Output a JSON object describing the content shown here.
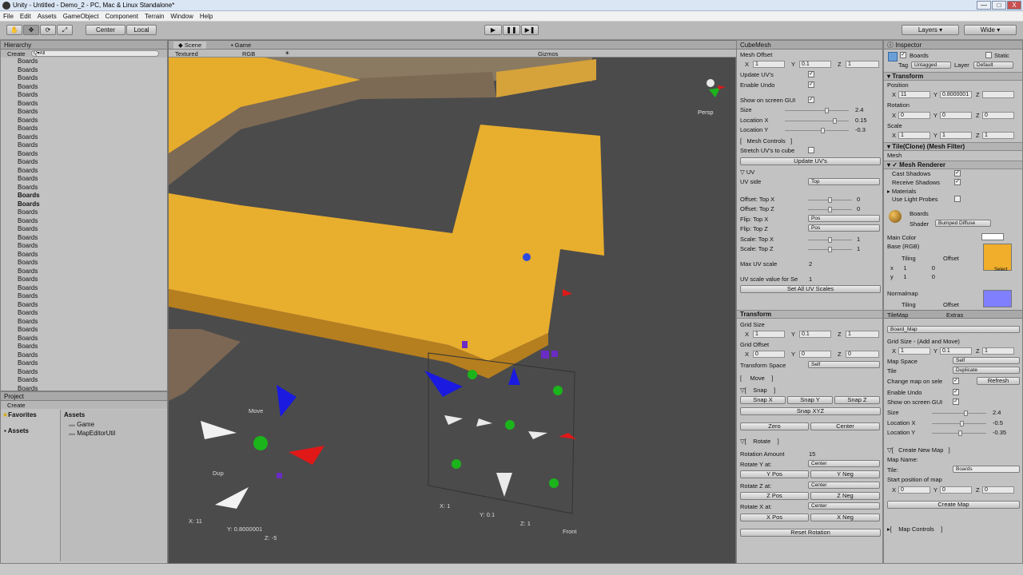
{
  "window": {
    "title": "Unity - Untitled - Demo_2 - PC, Mac & Linux Standalone*",
    "min": "—",
    "max": "□",
    "close": "X"
  },
  "menu": [
    "File",
    "Edit",
    "Assets",
    "GameObject",
    "Component",
    "Terrain",
    "Window",
    "Help"
  ],
  "toolbar": {
    "center": "Center",
    "local": "Local",
    "layers": "Layers",
    "layout": "Wide"
  },
  "hierarchy": {
    "title": "Hierarchy",
    "create": "Create",
    "search": "Q▾All",
    "items": [
      "Boards",
      "Boards",
      "Boards",
      "Boards",
      "Boards",
      "Boards",
      "Boards",
      "Boards",
      "Boards",
      "Boards",
      "Boards",
      "Boards",
      "Boards",
      "Boards",
      "Boards",
      "Boards",
      "Boards",
      "Boards",
      "Boards",
      "Boards",
      "Boards",
      "Boards",
      "Boards",
      "Boards",
      "Boards",
      "Boards",
      "Boards",
      "Boards",
      "Boards",
      "Boards",
      "Boards",
      "Boards",
      "Boards",
      "Boards",
      "Boards",
      "Boards",
      "Boards",
      "Boards",
      "Boards",
      "Boards"
    ],
    "selected": [
      16,
      17
    ]
  },
  "project": {
    "title": "Project",
    "create": "Create",
    "favorites": "Favorites",
    "assets": "Assets",
    "assets_header": "Assets",
    "folders": [
      "Game",
      "MapEditorUtil"
    ]
  },
  "scene": {
    "tab_scene": "Scene",
    "tab_game": "Game",
    "textured": "Textured",
    "rgb": "RGB",
    "gizmos": "Gizmos",
    "persp": "Persp",
    "labels": {
      "move": "Move",
      "dup": "Dup",
      "x1": "X: 11",
      "y1": "Y: 0.8000001",
      "z1": "Z: -5",
      "x2": "X: 1",
      "y2": "Y: 0.1",
      "z2": "Z: 1",
      "front": "Front"
    }
  },
  "cubemesh": {
    "title": "CubeMesh",
    "mesh_offset": "Mesh Offset",
    "x": "X",
    "x_val": "1",
    "y": "Y",
    "y_val": "0.1",
    "z": "Z",
    "z_val": "1",
    "update_uvs": "Update UV's",
    "enable_undo": "Enable Undo",
    "show_gui": "Show on screen GUI",
    "size": "Size",
    "size_val": "2.4",
    "loc_x": "Location X",
    "loc_x_val": "0.15",
    "loc_y": "Location Y",
    "loc_y_val": "-0.3",
    "mesh_controls": "Mesh Controls",
    "stretch": "Stretch UV's to cube",
    "update_btn": "Update UV's",
    "uv": "UV",
    "uv_side": "UV side",
    "uv_side_val": "Top",
    "off_top_x": "Offset: Top X",
    "off_top_x_val": "0",
    "off_top_z": "Offset: Top Z",
    "off_top_z_val": "0",
    "flip_top_x": "Flip: Top X",
    "flip_top_x_val": "Pos",
    "flip_top_z": "Flip: Top Z",
    "flip_top_z_val": "Pos",
    "scale_top_x": "Scale: Top X",
    "scale_top_x_val": "1",
    "scale_top_z": "Scale: Top Z",
    "scale_top_z_val": "1",
    "max_uv": "Max UV scale",
    "max_uv_val": "2",
    "uv_for_sel": "UV scale value for Se",
    "uv_for_sel_val": "1",
    "set_all": "Set All UV Scales"
  },
  "transform_tool": {
    "title": "Transform",
    "grid_size": "Grid Size",
    "gx": "1",
    "gy": "0.1",
    "gz": "1",
    "grid_offset": "Grid Offset",
    "ox": "0",
    "oy": "0",
    "oz": "0",
    "space": "Transform Space",
    "space_val": "Self",
    "move": "Move",
    "snap": "Snap",
    "snap_x": "Snap X",
    "snap_y": "Snap Y",
    "snap_z": "Snap Z",
    "snap_xyz": "Snap XYZ",
    "zero": "Zero",
    "center": "Center",
    "rotate": "Rotate",
    "rot_amount": "Rotation Amount",
    "rot_amount_val": "15",
    "rot_y": "Rotate Y at:",
    "rot_z": "Rotate Z at:",
    "rot_x": "Rotate X at:",
    "center_val": "Center",
    "y_pos": "Y Pos",
    "y_neg": "Y Neg",
    "z_pos": "Z Pos",
    "z_neg": "Z Neg",
    "x_pos": "X Pos",
    "x_neg": "X Neg",
    "reset_rot": "Reset Rotation"
  },
  "inspector": {
    "title": "Inspector",
    "name": "Boards",
    "static": "Static",
    "tag": "Tag",
    "tag_val": "Untagged",
    "layer": "Layer",
    "layer_val": "Default",
    "transform": "Transform",
    "position": "Position",
    "px": "11",
    "py": "0.8000001",
    "pz": "",
    "rotation": "Rotation",
    "rx": "0",
    "ry": "0",
    "rz": "0",
    "scale": "Scale",
    "sx": "1",
    "sy": "1",
    "sz": "1",
    "mesh_filter": "Tile(Clone) (Mesh Filter)",
    "mesh": "Mesh",
    "mesh_renderer": "Mesh Renderer",
    "cast_shadows": "Cast Shadows",
    "receive_shadows": "Receive Shadows",
    "materials": "Materials",
    "light_probes": "Use Light Probes",
    "material": "Boards",
    "shader": "Shader",
    "shader_val": "Bumped Diffuse",
    "main_color": "Main Color",
    "base": "Base (RGB)",
    "tiling": "Tiling",
    "offset": "Offset",
    "t1": "1",
    "t0": "0",
    "select": "Select",
    "normalmap": "Normalmap"
  },
  "tilemap": {
    "title": "TileMap",
    "extras": "Extras",
    "board_map": "Board_Map",
    "grid_size": "Grid Size - (Add and Move)",
    "gx": "1",
    "gy": "0.1",
    "gz": "1",
    "map_space": "Map Space",
    "map_space_val": "Self",
    "tile": "Tile",
    "tile_val": "Duplicate",
    "change_map": "Change map on sele",
    "refresh": "Refresh",
    "enable_undo": "Enable Undo",
    "show_gui": "Show on screen GUI",
    "size": "Size",
    "size_val": "2.4",
    "loc_x": "Location X",
    "loc_x_val": "-0.5",
    "loc_y": "Location Y",
    "loc_y_val": "-0.35",
    "create_new": "Create New Map",
    "map_name": "Map Name:",
    "tile2": "Tile:",
    "tile2_val": "Boards",
    "start_pos": "Start position of map",
    "spx": "0",
    "spy": "0",
    "spz": "0",
    "create_map": "Create Map",
    "map_controls": "Map Controls"
  }
}
